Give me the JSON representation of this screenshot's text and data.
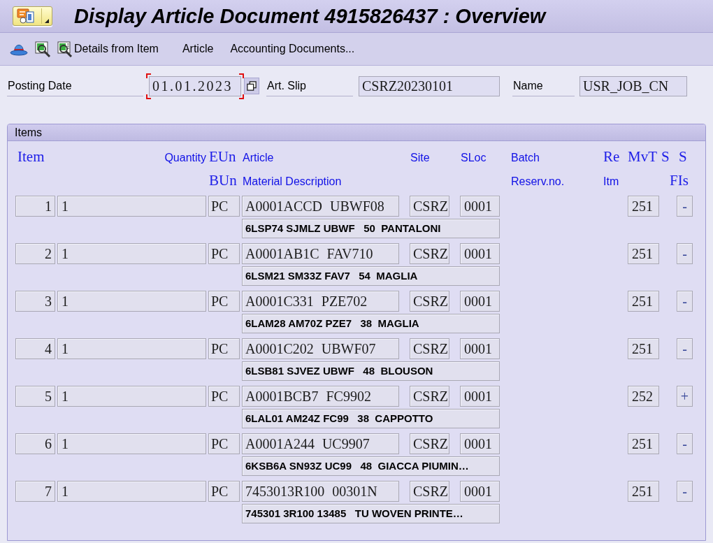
{
  "title_bar": {
    "title": "Display Article Document 4915826437 : Overview"
  },
  "toolbar": {
    "buttons": [
      {
        "label": "Details from Item",
        "kind": "icon_label"
      },
      {
        "label": "Article",
        "kind": "text"
      },
      {
        "label": "Accounting Documents...",
        "kind": "text"
      }
    ]
  },
  "header": {
    "fields": [
      {
        "label": "Posting Date",
        "value": "01.01.2023",
        "kind": "date",
        "focused": true
      },
      {
        "label": "Art. Slip",
        "value": "CSRZ20230101",
        "kind": "text",
        "focused": false
      },
      {
        "label": "Name",
        "value": "USR_JOB_CN",
        "kind": "text",
        "focused": false
      }
    ]
  },
  "items_panel": {
    "title": "Items",
    "header_line_1": [
      "Item",
      "Quantity",
      "EUn",
      "Article",
      "Site",
      "SLoc",
      "Batch",
      "Re",
      "MvT",
      "S",
      "S"
    ],
    "header_line_2": [
      "BUn",
      "Material Description",
      "Reserv.no.",
      "Itm",
      "FIs"
    ],
    "rows": [
      {
        "item": "1",
        "quantity": "1",
        "unit": "PC",
        "article": "A0001ACCD UBWF08",
        "site": "CSRZ",
        "sloc": "0001",
        "mvt": "251",
        "debit_credit": "-",
        "description": "6LSP74 SJMLZ UBWF   50  PANTALONI"
      },
      {
        "item": "2",
        "quantity": "1",
        "unit": "PC",
        "article": "A0001AB1C FAV710",
        "site": "CSRZ",
        "sloc": "0001",
        "mvt": "251",
        "debit_credit": "-",
        "description": "6LSM21 SM33Z FAV7   54  MAGLIA"
      },
      {
        "item": "3",
        "quantity": "1",
        "unit": "PC",
        "article": "A0001C331 PZE702",
        "site": "CSRZ",
        "sloc": "0001",
        "mvt": "251",
        "debit_credit": "-",
        "description": "6LAM28 AM70Z PZE7   38  MAGLIA"
      },
      {
        "item": "4",
        "quantity": "1",
        "unit": "PC",
        "article": "A0001C202 UBWF07",
        "site": "CSRZ",
        "sloc": "0001",
        "mvt": "251",
        "debit_credit": "-",
        "description": "6LSB81 SJVEZ UBWF   48  BLOUSON"
      },
      {
        "item": "5",
        "quantity": "1",
        "unit": "PC",
        "article": "A0001BCB7 FC9902",
        "site": "CSRZ",
        "sloc": "0001",
        "mvt": "252",
        "debit_credit": "+",
        "description": "6LAL01 AM24Z FC99   38  CAPPOTTO"
      },
      {
        "item": "6",
        "quantity": "1",
        "unit": "PC",
        "article": "A0001A244 UC9907",
        "site": "CSRZ",
        "sloc": "0001",
        "mvt": "251",
        "debit_credit": "-",
        "description": "6KSB6A SN93Z UC99   48  GIACCA PIUMIN…"
      },
      {
        "item": "7",
        "quantity": "1",
        "unit": "PC",
        "article": "7453013R100 00301N",
        "site": "CSRZ",
        "sloc": "0001",
        "mvt": "251",
        "debit_credit": "-",
        "description": "745301 3R100 13485   TU WOVEN PRINTE…"
      }
    ]
  }
}
